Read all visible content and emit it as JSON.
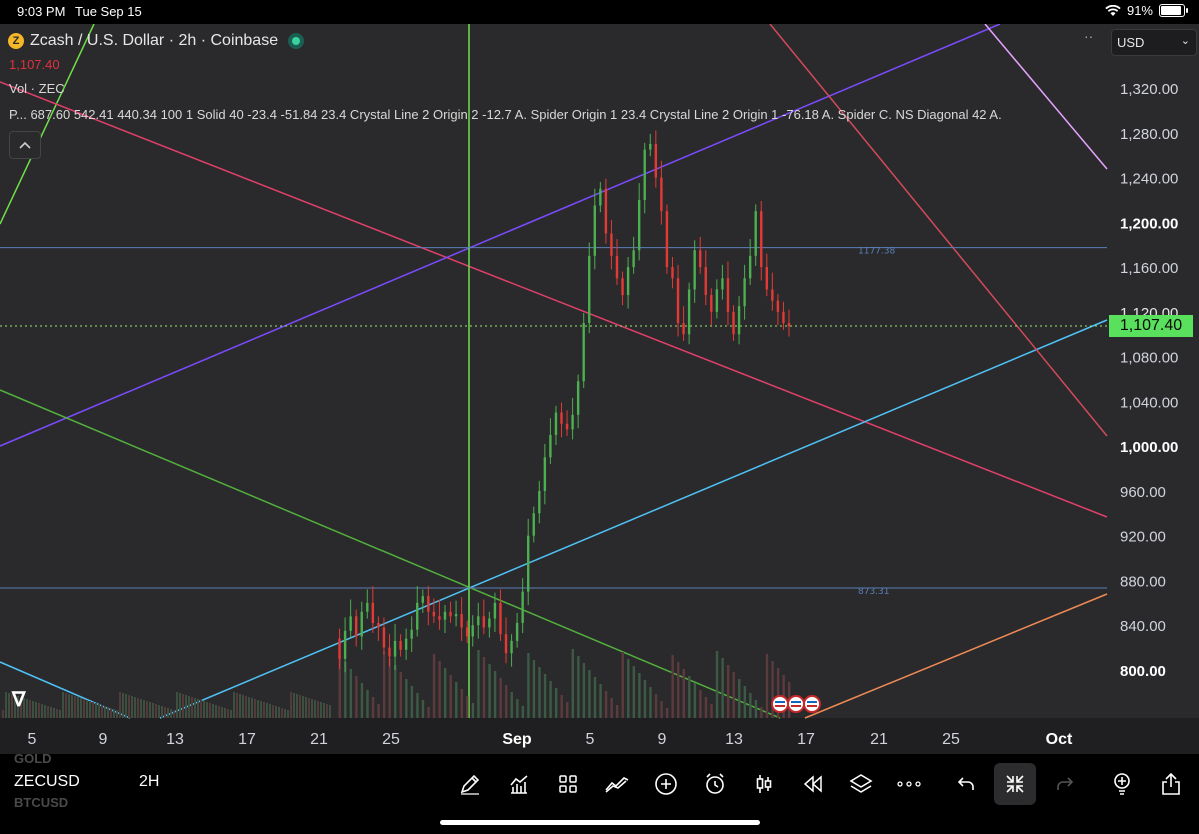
{
  "status_bar": {
    "time": "9:03 PM",
    "date": "Tue Sep 15",
    "battery_pct": "91%",
    "battery_level": 0.91
  },
  "header": {
    "title": "Zcash / U.S. Dollar · 2h · Coinbase",
    "price": "1,107.40",
    "vol_label": "Vol · ZEC",
    "indicator_label": "P... 687.60 542.41 440.34 100 1 Solid 40 -23.4 -51.84 23.4 Crystal Line 2 Origin 2 -12.7 A. Spider Origin 1 23.4 Crystal Line 2 Origin 1 -76.18 A. Spider C. NS Diagonal 42 A.",
    "currency": "USD"
  },
  "colors": {
    "background": "#2a2a2c",
    "up": "#4caf50",
    "down": "#e53935",
    "badge": "#59e05c",
    "hline": "#5b7fb8"
  },
  "chart_data": {
    "type": "candlestick",
    "symbol": "ZECUSD",
    "interval": "2H",
    "current_price": 1107.4,
    "y_axis": {
      "min": 760,
      "max": 1360,
      "ticks": [
        "1,320.00",
        "1,280.00",
        "1,240.00",
        "1,200.00",
        "1,160.00",
        "1,120.00",
        "1,080.00",
        "1,040.00",
        "1,000.00",
        "960.00",
        "920.00",
        "880.00",
        "840.00",
        "800.00"
      ]
    },
    "x_axis": {
      "ticks": [
        "5",
        "9",
        "13",
        "17",
        "21",
        "25",
        "Sep",
        "5",
        "9",
        "13",
        "17",
        "21",
        "25",
        "Oct"
      ]
    },
    "horizontal_levels": [
      {
        "value": 1177.38,
        "label": "1177.38"
      },
      {
        "value": 873.31,
        "label": "873.31"
      }
    ],
    "close_path": [
      [
        0,
        828
      ],
      [
        4,
        810
      ],
      [
        8,
        835
      ],
      [
        12,
        848
      ],
      [
        16,
        830
      ],
      [
        20,
        852
      ],
      [
        24,
        860
      ],
      [
        28,
        842
      ],
      [
        32,
        838
      ],
      [
        36,
        820
      ],
      [
        40,
        812
      ],
      [
        44,
        826
      ],
      [
        48,
        818
      ],
      [
        52,
        828
      ],
      [
        56,
        836
      ],
      [
        60,
        860
      ],
      [
        64,
        866
      ],
      [
        68,
        852
      ],
      [
        72,
        848
      ],
      [
        76,
        845
      ],
      [
        80,
        852
      ],
      [
        84,
        848
      ],
      [
        88,
        850
      ],
      [
        92,
        838
      ],
      [
        96,
        830
      ],
      [
        100,
        840
      ],
      [
        104,
        848
      ],
      [
        108,
        838
      ],
      [
        112,
        846
      ],
      [
        116,
        860
      ],
      [
        120,
        832
      ],
      [
        124,
        815
      ],
      [
        128,
        826
      ],
      [
        132,
        842
      ],
      [
        136,
        870
      ],
      [
        140,
        920
      ],
      [
        144,
        940
      ],
      [
        148,
        960
      ],
      [
        152,
        990
      ],
      [
        156,
        1010
      ],
      [
        160,
        1030
      ],
      [
        164,
        1020
      ],
      [
        168,
        1015
      ],
      [
        172,
        1028
      ],
      [
        176,
        1058
      ],
      [
        180,
        1110
      ],
      [
        184,
        1170
      ],
      [
        188,
        1215
      ],
      [
        192,
        1230
      ],
      [
        196,
        1190
      ],
      [
        200,
        1170
      ],
      [
        204,
        1150
      ],
      [
        208,
        1135
      ],
      [
        212,
        1160
      ],
      [
        216,
        1175
      ],
      [
        220,
        1220
      ],
      [
        224,
        1265
      ],
      [
        228,
        1270
      ],
      [
        232,
        1240
      ],
      [
        236,
        1210
      ],
      [
        240,
        1160
      ],
      [
        244,
        1150
      ],
      [
        248,
        1110
      ],
      [
        252,
        1100
      ],
      [
        256,
        1140
      ],
      [
        260,
        1175
      ],
      [
        264,
        1160
      ],
      [
        268,
        1135
      ],
      [
        272,
        1120
      ],
      [
        276,
        1140
      ],
      [
        280,
        1150
      ],
      [
        284,
        1120
      ],
      [
        288,
        1100
      ],
      [
        292,
        1125
      ],
      [
        296,
        1150
      ],
      [
        300,
        1170
      ],
      [
        304,
        1210
      ],
      [
        308,
        1160
      ],
      [
        312,
        1140
      ],
      [
        316,
        1130
      ],
      [
        320,
        1120
      ],
      [
        324,
        1110
      ],
      [
        328,
        1107
      ]
    ],
    "events": [
      "US",
      "US",
      "US"
    ]
  },
  "bottom_bar": {
    "symbol": "ZECUSD",
    "interval": "2H",
    "ghost_top": "GOLD",
    "ghost_bottom": "BTCUSD",
    "tools": [
      "draw-icon",
      "indicators-icon",
      "templates-icon",
      "compare-icon",
      "add-icon",
      "alert-icon",
      "candle-type-icon",
      "replay-icon",
      "layers-icon",
      "more-icon",
      "undo-icon",
      "fullscreen-exit-icon",
      "redo-icon",
      "idea-icon",
      "share-icon"
    ]
  }
}
